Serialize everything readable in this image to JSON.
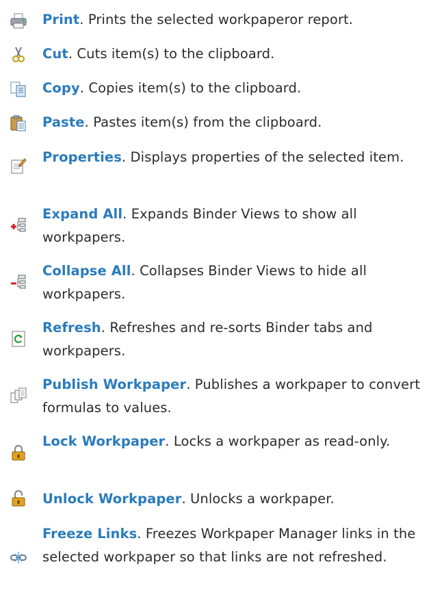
{
  "colors": {
    "term": "#2a7bbd",
    "text": "#2b2b2b",
    "background": "#ffffff"
  },
  "items": [
    {
      "icon": "printer-icon",
      "term": "Print",
      "description": ". Prints the selected workpaperor report."
    },
    {
      "icon": "scissors-icon",
      "term": "Cut",
      "description": ". Cuts item(s) to the clipboard."
    },
    {
      "icon": "copy-icon",
      "term": "Copy",
      "description": ". Copies item(s) to the clipboard."
    },
    {
      "icon": "paste-icon",
      "term": "Paste",
      "description": ". Pastes item(s) from the clipboard."
    },
    {
      "icon": "properties-icon",
      "term": "Properties",
      "description": ". Displays properties of the selected item."
    },
    {
      "icon": "expand-all-icon",
      "term": "Expand All",
      "description": ". Expands Binder Views to show all workpapers."
    },
    {
      "icon": "collapse-all-icon",
      "term": "Collapse All",
      "description": ". Collapses Binder Views to hide all workpapers."
    },
    {
      "icon": "refresh-icon",
      "term": "Refresh",
      "description": ". Refreshes and re-sorts Binder tabs and workpapers."
    },
    {
      "icon": "publish-icon",
      "term": "Publish Workpaper",
      "description": ". Publishes a workpaper to convert formulas to values."
    },
    {
      "icon": "lock-icon",
      "term": "Lock Workpaper",
      "description": ". Locks a workpaper as read-only."
    },
    {
      "icon": "unlock-icon",
      "term": "Unlock Workpaper",
      "description": ". Unlocks a workpaper."
    },
    {
      "icon": "freeze-links-icon",
      "term": "Freeze Links",
      "description": ". Freezes Workpaper Manager links in the selected workpaper so that links are not refreshed."
    }
  ]
}
